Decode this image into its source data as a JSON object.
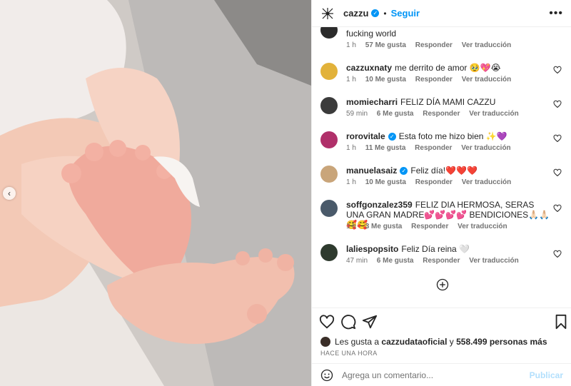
{
  "header": {
    "username": "cazzu",
    "follow_label": "Seguir",
    "more_label": "•••"
  },
  "comments": [
    {
      "user": "",
      "text": "fucking world",
      "time": "1 h",
      "likes": "57 Me gusta",
      "reply": "Responder",
      "translate": "Ver traducción",
      "avatar_color": "#2b2b2b"
    },
    {
      "user": "cazzuxnaty",
      "text": "me derrito de amor 🥹💖😭",
      "time": "1 h",
      "likes": "10 Me gusta",
      "reply": "Responder",
      "translate": "Ver traducción",
      "avatar_color": "#e2b23a"
    },
    {
      "user": "momiecharri",
      "text": "FELIZ DÍA MAMI CAZZU",
      "time": "59 min",
      "likes": "6 Me gusta",
      "reply": "Responder",
      "translate": "Ver traducción",
      "avatar_color": "#3b3b3b"
    },
    {
      "user": "rorovitale",
      "text": "Esta foto me hizo bien ✨💜",
      "time": "1 h",
      "likes": "11 Me gusta",
      "reply": "Responder",
      "translate": "Ver traducción",
      "avatar_color": "#b0306a"
    },
    {
      "user": "manuelasaiz",
      "text": "Feliz día!❤️❤️❤️",
      "time": "1 h",
      "likes": "10 Me gusta",
      "reply": "Responder",
      "translate": "Ver traducción",
      "avatar_color": "#c9a57a"
    },
    {
      "user": "soffgonzalez359",
      "text": "FELIZ DIA HERMOSA, SERAS UNA GRAN MADRE💕💕💕💕 BENDICIONES🙏🏻🙏🏻🥰🥰",
      "time": "1 h",
      "likes": "3 Me gusta",
      "reply": "Responder",
      "translate": "Ver traducción",
      "avatar_color": "#4a5a6a"
    },
    {
      "user": "laliespopsito",
      "text": "Feliz Día reina 🤍",
      "time": "47 min",
      "likes": "6 Me gusta",
      "reply": "Responder",
      "translate": "Ver traducción",
      "avatar_color": "#2e3a2e"
    }
  ],
  "likes": {
    "prefix": "Les gusta a",
    "user": "cazzudataoficial",
    "middle": "y",
    "others": "558.499 personas más"
  },
  "time_ago": "HACE UNA HORA",
  "comment_box": {
    "placeholder": "Agrega un comentario...",
    "publish_label": "Publicar"
  },
  "colors": {
    "accent": "#0095f6",
    "muted": "#737373",
    "border": "#efefef"
  }
}
